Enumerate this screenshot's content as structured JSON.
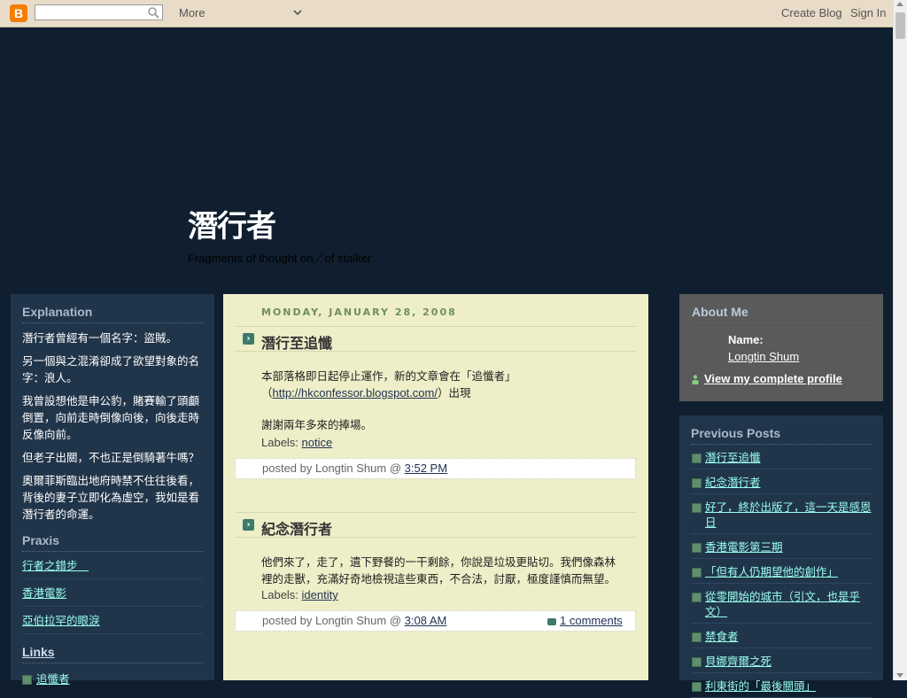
{
  "navbar": {
    "logo_letter": "B",
    "search_placeholder": "",
    "more_label": "More",
    "create_blog_label": "Create Blog",
    "sign_in_label": "Sign In"
  },
  "header": {
    "title": "潛行者",
    "description": "Fragments of thought on／of stalker"
  },
  "explanation": {
    "heading": "Explanation",
    "paragraphs": [
      "潛行者曾經有一個名字：盜賊。",
      "另一個與之混淆卻成了欲望對象的名字：浪人。",
      "我曾設想他是申公豹，賭賽輸了頭顱倒置，向前走時倒像向後，向後走時反像向前。",
      "但老子出關，不也正是倒騎著牛嗎？",
      "奧爾菲斯臨出地府時禁不住往後看，背後的妻子立即化為虛空，我如是看潛行者的命運。"
    ]
  },
  "praxis": {
    "heading": "Praxis",
    "items": [
      "行者之錯步　",
      "香港電影",
      "亞伯拉罕的眼淚"
    ]
  },
  "links": {
    "heading": "Links",
    "items": [
      "追懺者"
    ]
  },
  "main": {
    "date": "MONDAY, JANUARY 28, 2008",
    "posts": [
      {
        "title": "潛行至追懺",
        "body_1": "本部落格即日起停止運作，新的文章會在「追懺者」",
        "body_2_pre": "（",
        "link": "http://hkconfessor.blogspot.com/",
        "body_2_post": "）出現",
        "body_3": "謝謝兩年多來的捧場。",
        "labels_prefix": "Labels:",
        "label": "notice",
        "footer_prefix": "posted by Longtin Shum @",
        "time": "3:52 PM"
      },
      {
        "title": "紀念潛行者",
        "body_1": "他們來了，走了，遺下野餐的一干剩餘，你說是垃圾更貼切。我們像森林裡的走獸，充滿好奇地檢視這些東西，不合法，討厭，極度謹慎而無望。",
        "labels_prefix": "Labels:",
        "label": "identity",
        "footer_prefix": "posted by Longtin Shum @",
        "time": "3:08 AM",
        "comments": "1 comments"
      }
    ]
  },
  "about": {
    "heading": "About Me",
    "name_label": "Name:",
    "name": "Longtin Shum",
    "profile_link": "View my complete profile"
  },
  "previous_posts": {
    "heading": "Previous Posts",
    "items": [
      "潛行至追懺",
      "紀念潛行者",
      "好了，終於出版了，這一天是感恩日",
      "香港電影第三期",
      "「但有人仍期望他的創作」",
      "從零開始的城市（引文，也是乎文）",
      "禁食者",
      "貝娜齊爾之死",
      "利東街的「最後關頭」"
    ]
  }
}
